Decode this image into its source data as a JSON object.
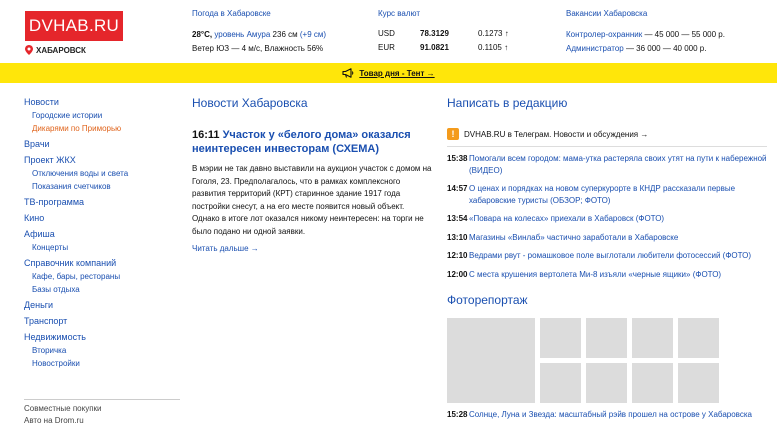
{
  "header": {
    "logo": "DVHAB.RU",
    "city": "ХАБАРОВСК",
    "weather": {
      "title": "Погода в Хабаровске",
      "temp": "28°C,",
      "river_label": "уровень Амура",
      "river_value": "236 см",
      "river_change": "(+9 см)",
      "wind_line": "Ветер ЮЗ — 4 м/с, Влажность 56%"
    },
    "currency": {
      "title": "Курс валют",
      "rows": [
        {
          "code": "USD",
          "value": "78.3129",
          "change": "0.1273 ↑"
        },
        {
          "code": "EUR",
          "value": "91.0821",
          "change": "0.1105 ↑"
        }
      ]
    },
    "jobs": {
      "title": "Вакансии Хабаровска",
      "items": [
        {
          "label": "Контролер-охранник",
          "salary": " — 45 000 — 55 000 р."
        },
        {
          "label": "Администратор",
          "salary": " — 36 000 — 40 000 р."
        }
      ]
    }
  },
  "banner": {
    "text": "Товар дня - Тент →",
    "icon": "megaphone-icon"
  },
  "sidebar": {
    "items": [
      {
        "label": "Новости",
        "level": "main"
      },
      {
        "label": "Городские истории",
        "level": "sub"
      },
      {
        "label": "Дикарями по Приморью",
        "level": "sub-orange"
      },
      {
        "label": "Врачи",
        "level": "main"
      },
      {
        "label": "Проект ЖКХ",
        "level": "main"
      },
      {
        "label": "Отключения воды и света",
        "level": "sub"
      },
      {
        "label": "Показания счетчиков",
        "level": "sub"
      },
      {
        "label": "ТВ-программа",
        "level": "main"
      },
      {
        "label": "Кино",
        "level": "main"
      },
      {
        "label": "Афиша",
        "level": "main"
      },
      {
        "label": "Концерты",
        "level": "sub"
      },
      {
        "label": "Справочник компаний",
        "level": "main"
      },
      {
        "label": "Кафе, бары, рестораны",
        "level": "sub"
      },
      {
        "label": "Базы отдыха",
        "level": "sub"
      },
      {
        "label": "Деньги",
        "level": "main"
      },
      {
        "label": "Транспорт",
        "level": "main"
      },
      {
        "label": "Недвижимость",
        "level": "main"
      },
      {
        "label": "Вторичка",
        "level": "sub"
      },
      {
        "label": "Новостройки",
        "level": "sub"
      }
    ],
    "extra": [
      "Совместные покупки",
      "Авто на Drom.ru"
    ]
  },
  "main": {
    "title": "Новости Хабаровска",
    "headline_time": "16:11",
    "headline": "Участок у «белого дома» оказался неинтересен инвесторам (СХЕМА)",
    "body": "В мэрии не так давно выставили на аукцион участок с домом на Гоголя, 23. Предполагалось, что в рамках комплексного развития территорий (КРТ) старинное здание 1917 года постройки снесут, а на его месте появится новый объект. Однако в итоге лот оказался никому неинтересен: на торги не было подано ни одной заявки.",
    "read_more": "Читать дальше →"
  },
  "right": {
    "title": "Написать в редакцию",
    "telegram": "DVHAB.RU в Телеграм. Новости и обсуждения →",
    "feed": [
      {
        "time": "15:38",
        "text": "Помогали всем городом: мама-утка растеряла своих утят на пути к набережной (ВИДЕО)"
      },
      {
        "time": "14:57",
        "text": "О ценах и порядках на новом суперкурорте в КНДР рассказали первые хабаровские туристы (ОБЗОР; ФОТО)"
      },
      {
        "time": "13:54",
        "text": "«Повара на колесах» приехали в Хабаровск (ФОТО)"
      },
      {
        "time": "13:10",
        "text": "Магазины «Винлаб» частично заработали в Хабаровске"
      },
      {
        "time": "12:10",
        "text": "Ведрами рвут - ромашковое поле выглотали любители фотосессий (ФОТО)"
      },
      {
        "time": "12:00",
        "text": "С места крушения вертолета Ми-8 изъяли «черные ящики» (ФОТО)"
      }
    ],
    "photo_title": "Фоторепортаж",
    "bottom_time": "15:28",
    "bottom_text": "Солнце, Луна и Звезда: масштабный рэйв прошел на острове у Хабаровска"
  },
  "colors": {
    "brand_red": "#e5262b",
    "banner_yellow": "#ffe60a",
    "link_blue": "#1a4fb0",
    "green": "#1a8f2e",
    "orange": "#e0641c"
  }
}
